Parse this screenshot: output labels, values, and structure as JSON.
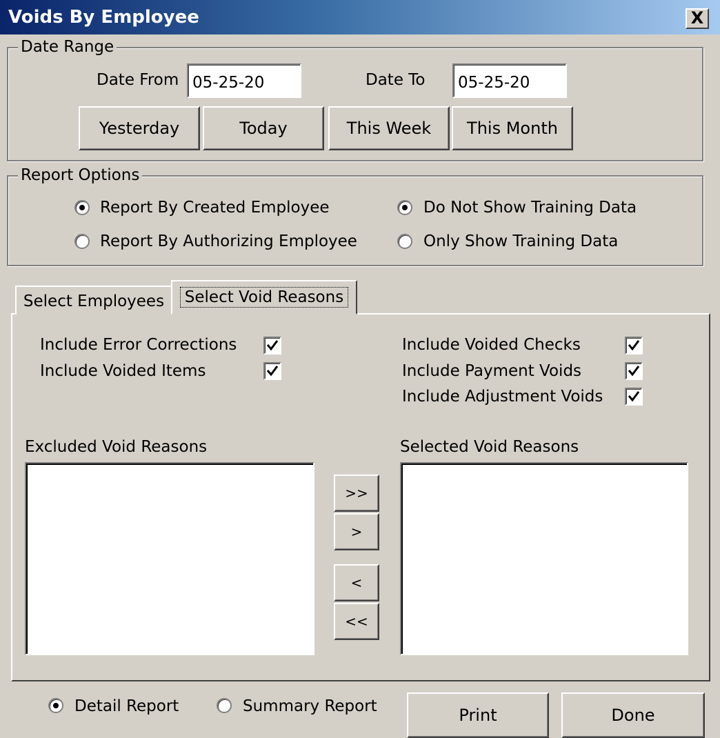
{
  "window": {
    "title": "Voids By Employee",
    "close_glyph": "X"
  },
  "date_range": {
    "legend": "Date Range",
    "date_from_label": "Date From",
    "date_from_value": "05-25-20",
    "date_to_label": "Date To",
    "date_to_value": "05-25-20",
    "buttons": [
      "Yesterday",
      "Today",
      "This Week",
      "This Month"
    ]
  },
  "report_options": {
    "legend": "Report Options",
    "employee_options": [
      {
        "label": "Report By Created Employee",
        "checked": true
      },
      {
        "label": "Report By Authorizing Employee",
        "checked": false
      }
    ],
    "training_options": [
      {
        "label": "Do Not Show Training Data",
        "checked": true
      },
      {
        "label": "Only Show Training Data",
        "checked": false
      }
    ]
  },
  "tabs": [
    {
      "label": "Select Employees",
      "active": false
    },
    {
      "label": "Select Void Reasons",
      "active": true
    }
  ],
  "void_reasons_tab": {
    "left_checks": [
      {
        "label": "Include Error Corrections",
        "checked": true
      },
      {
        "label": "Include Voided Items",
        "checked": true
      }
    ],
    "right_checks": [
      {
        "label": "Include Voided Checks",
        "checked": true
      },
      {
        "label": "Include Payment Voids",
        "checked": true
      },
      {
        "label": "Include Adjustment Voids",
        "checked": true
      }
    ],
    "excluded_label": "Excluded Void Reasons",
    "selected_label": "Selected Void Reasons",
    "move_buttons": [
      ">>",
      ">",
      "<",
      "<<"
    ]
  },
  "footer": {
    "report_types": [
      {
        "label": "Detail Report",
        "checked": true
      },
      {
        "label": "Summary Report",
        "checked": false
      }
    ],
    "print_label": "Print",
    "done_label": "Done"
  },
  "colors": {
    "face": "#d4d0c8",
    "title_start": "#0a246a",
    "title_end": "#a6caf0"
  }
}
